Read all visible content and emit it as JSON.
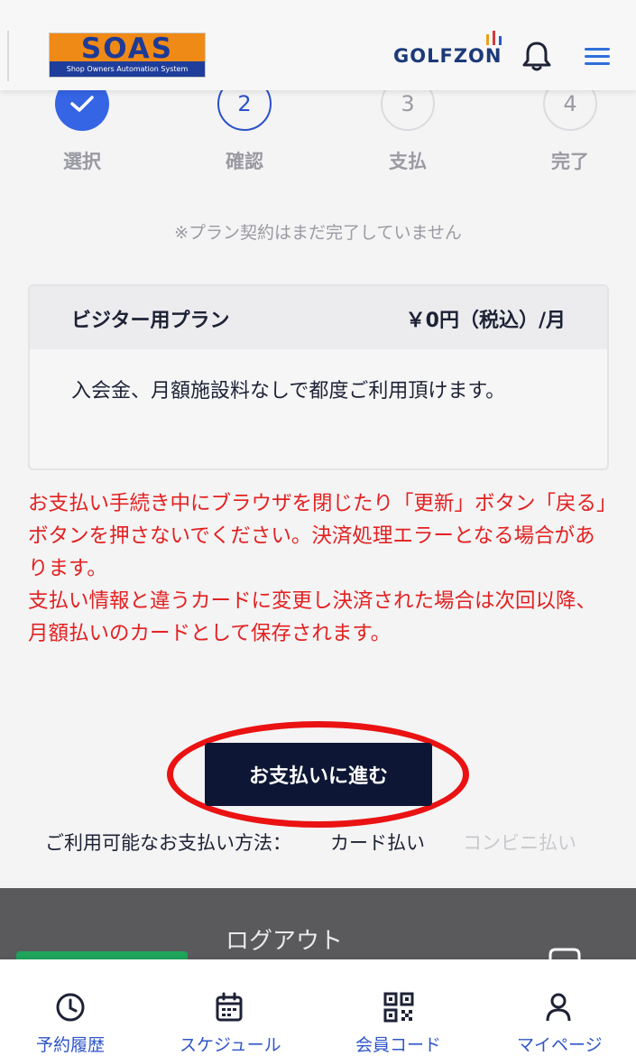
{
  "header": {
    "logo_text": "SOAS",
    "logo_subtitle": "Shop Owners Automation System",
    "brand": "GOLFZON",
    "icons": [
      "bell-icon",
      "menu-icon"
    ]
  },
  "steps": [
    {
      "number": "",
      "label": "選択",
      "state": "done"
    },
    {
      "number": "2",
      "label": "確認",
      "state": "active"
    },
    {
      "number": "3",
      "label": "支払",
      "state": "todo"
    },
    {
      "number": "4",
      "label": "完了",
      "state": "todo"
    }
  ],
  "notice": "※プラン契約はまだ完了していません",
  "plan": {
    "name": "ビジター用プラン",
    "price": "￥0円（税込）/月",
    "description": "入会金、月額施設料なしで都度ご利用頂けます。"
  },
  "warning": [
    "お支払い手続き中にブラウザを閉じたり「更新」ボタン「戻る」ボタンを押さないでください。決済処理エラーとなる場合があります。",
    "支払い情報と違うカードに変更し決済された場合は次回以降、月額払いのカードとして保存されます。"
  ],
  "pay_button": "お支払いに進む",
  "payment_methods": {
    "label": "ご利用可能なお支払い方法：",
    "card": "カード払い",
    "convenience": "コンビニ払い"
  },
  "footer": {
    "logout": "ログアウト"
  },
  "bottom_nav": [
    {
      "label": "予約履歴",
      "icon": "clock-icon"
    },
    {
      "label": "スケジュール",
      "icon": "calendar-icon"
    },
    {
      "label": "会員コード",
      "icon": "qr-code-icon"
    },
    {
      "label": "マイページ",
      "icon": "person-icon"
    }
  ],
  "colors": {
    "primary": "#3565e4",
    "dark_button": "#0d1735",
    "warning": "#e32121",
    "nav_label": "#2f56c9",
    "footer": "#5a5a5c"
  }
}
